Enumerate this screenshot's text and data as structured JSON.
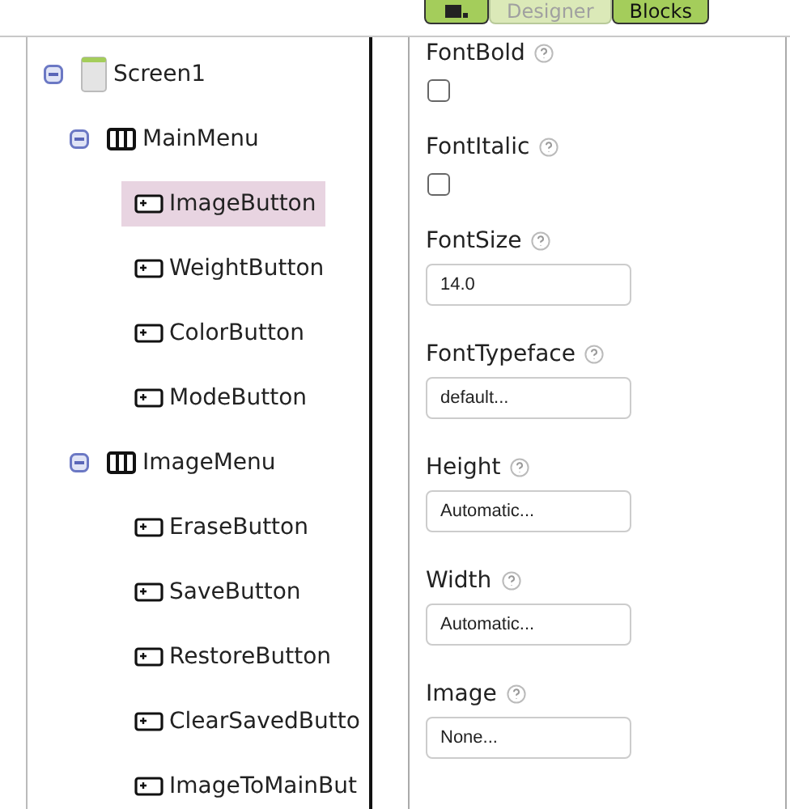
{
  "toolbar": {
    "buttons": [
      {
        "kind": "icon",
        "selected": false
      },
      {
        "kind": "text",
        "label": "Designer",
        "selected": true
      },
      {
        "kind": "text",
        "label": "Blocks",
        "selected": false
      }
    ]
  },
  "tree": [
    {
      "label": "Screen1",
      "kind": "screen",
      "expanded": true,
      "selected": false,
      "children": [
        {
          "label": "MainMenu",
          "kind": "arrangement",
          "expanded": true,
          "selected": false,
          "children": [
            {
              "label": "ImageButton",
              "kind": "button",
              "selected": true
            },
            {
              "label": "WeightButton",
              "kind": "button",
              "selected": false
            },
            {
              "label": "ColorButton",
              "kind": "button",
              "selected": false
            },
            {
              "label": "ModeButton",
              "kind": "button",
              "selected": false
            }
          ]
        },
        {
          "label": "ImageMenu",
          "kind": "arrangement",
          "expanded": true,
          "selected": false,
          "children": [
            {
              "label": "EraseButton",
              "kind": "button",
              "selected": false
            },
            {
              "label": "SaveButton",
              "kind": "button",
              "selected": false
            },
            {
              "label": "RestoreButton",
              "kind": "button",
              "selected": false
            },
            {
              "label": "ClearSavedButto",
              "kind": "button",
              "selected": false
            },
            {
              "label": "ImageToMainBut",
              "kind": "button",
              "selected": false
            }
          ]
        }
      ]
    }
  ],
  "properties": [
    {
      "label": "FontBold",
      "kind": "checkbox",
      "checked": false
    },
    {
      "label": "FontItalic",
      "kind": "checkbox",
      "checked": false
    },
    {
      "label": "FontSize",
      "kind": "field",
      "value": "14.0"
    },
    {
      "label": "FontTypeface",
      "kind": "field",
      "value": "default..."
    },
    {
      "label": "Height",
      "kind": "field",
      "value": "Automatic..."
    },
    {
      "label": "Width",
      "kind": "field",
      "value": "Automatic..."
    },
    {
      "label": "Image",
      "kind": "field",
      "value": "None..."
    }
  ]
}
